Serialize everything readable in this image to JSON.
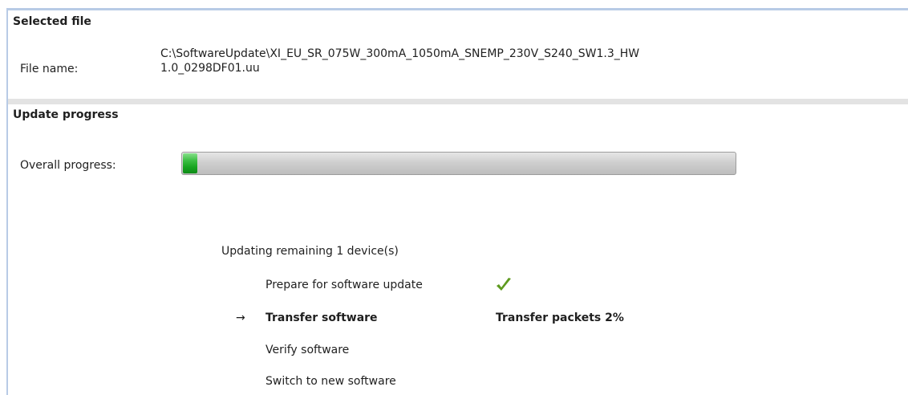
{
  "selected_file": {
    "section_title": "Selected file",
    "file_name_label": "File name:",
    "file_path_line1": "C:\\SoftwareUpdate\\XI_EU_SR_075W_300mA_1050mA_SNEMP_230V_S240_SW1.3_HW",
    "file_path_line2": "1.0_0298DF01.uu"
  },
  "update_progress": {
    "section_title": "Update progress",
    "overall_label": "Overall progress:",
    "overall_percent": 2,
    "remaining_text": "Updating remaining 1 device(s)",
    "steps": [
      {
        "label": "Prepare for software update",
        "state": "done",
        "status": "",
        "icon": "check-icon"
      },
      {
        "label": "Transfer software",
        "state": "active",
        "status": "Transfer packets 2%",
        "marker": "→"
      },
      {
        "label": "Verify software",
        "state": "pending",
        "status": ""
      },
      {
        "label": "Switch to new software",
        "state": "pending",
        "status": ""
      }
    ]
  },
  "colors": {
    "progress_fill": "#16a31f",
    "check": "#5e9a1f",
    "section_separator": "#e3e3e3",
    "frame": "#b8cbe6"
  }
}
